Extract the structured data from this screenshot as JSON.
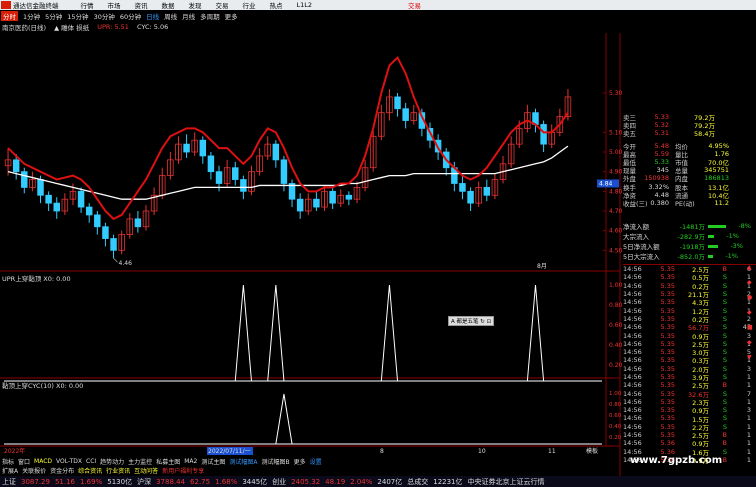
{
  "titlebar": {
    "app": "通达信金融终端",
    "menu": [
      "行情",
      "市场",
      "资讯",
      "数据",
      "发现",
      "交易",
      "行业",
      "热点",
      "L1L2"
    ],
    "trade": "交易"
  },
  "periods": [
    "分时",
    "1分钟",
    "5分钟",
    "15分钟",
    "30分钟",
    "60分钟",
    "日线",
    "周线",
    "月线",
    "多周期",
    "更多"
  ],
  "active_period": "分时",
  "info": {
    "stock": "南京医药(日线)",
    "lock": "▲ 雕体 损纸",
    "upr": "UPR: 5.51",
    "cyc": "CYC: 5.06"
  },
  "price_axis": [
    "5.30",
    "5.10",
    "5.00",
    "4.90",
    "4.80",
    "4.70",
    "4.60",
    "4.50"
  ],
  "low_label": "4.46",
  "price_tag": "4.84",
  "month_marker": "8月",
  "quote_rows": [
    {
      "l": "卖三",
      "p": "5.33",
      "v": "79.2万"
    },
    {
      "l": "卖四",
      "p": "5.32",
      "v": "79.2万"
    },
    {
      "l": "卖五",
      "p": "5.31",
      "v": "58.4万"
    }
  ],
  "stats": [
    {
      "l1": "今开",
      "v1": "5.48",
      "l2": "均价",
      "v2": "4.95%"
    },
    {
      "l1": "最高",
      "v1": "5.59",
      "l2": "量比",
      "v2": "1.76"
    },
    {
      "l1": "最低",
      "v1": "5.33",
      "l2": "市值",
      "v2": "70.0亿"
    },
    {
      "l1": "现量",
      "v1": "345",
      "l2": "总量",
      "v2": "345751"
    },
    {
      "l1": "外盘",
      "v1": "150938",
      "l2": "内盘",
      "v2": "186813"
    },
    {
      "l1": "换手",
      "v1": "3.32%",
      "l2": "股本",
      "v2": "13.1亿"
    },
    {
      "l1": "净资",
      "v1": "4.48",
      "l2": "流通",
      "v2": "10.4亿"
    },
    {
      "l1": "收益(三)",
      "v1": "0.380",
      "l2": "PE(动)",
      "v2": "11.2"
    }
  ],
  "flows": [
    {
      "label": "净流入额",
      "value": "-1481万",
      "pct": "-8%"
    },
    {
      "label": "大宗流入",
      "value": "-282.9万",
      "pct": "-1%"
    },
    {
      "label": "5日净流入额",
      "value": "-1918万",
      "pct": "-3%"
    },
    {
      "label": "5日大宗流入",
      "value": "-852.0万",
      "pct": "-1%"
    }
  ],
  "ticks": [
    {
      "t": "14:56",
      "p": "5.35",
      "v": "2.5万",
      "s": "B",
      "n": "6"
    },
    {
      "t": "14:56",
      "p": "5.35",
      "v": "0.5万",
      "s": "S",
      "n": "1"
    },
    {
      "t": "14:56",
      "p": "5.35",
      "v": "0.2万",
      "s": "S",
      "n": "1"
    },
    {
      "t": "14:56",
      "p": "5.35",
      "v": "21.1万",
      "s": "S",
      "n": "2"
    },
    {
      "t": "14:56",
      "p": "5.35",
      "v": "4.3万",
      "s": "S",
      "n": "1"
    },
    {
      "t": "14:56",
      "p": "5.35",
      "v": "1.2万",
      "s": "S",
      "n": "1"
    },
    {
      "t": "14:56",
      "p": "5.35",
      "v": "0.2万",
      "s": "S",
      "n": "2"
    },
    {
      "t": "14:56",
      "p": "5.35",
      "v": "56.7万",
      "s": "S",
      "n": "45"
    },
    {
      "t": "14:56",
      "p": "5.35",
      "v": "0.9万",
      "s": "S",
      "n": "3"
    },
    {
      "t": "14:56",
      "p": "5.35",
      "v": "2.5万",
      "s": "S",
      "n": "1"
    },
    {
      "t": "14:56",
      "p": "5.35",
      "v": "3.0万",
      "s": "S",
      "n": "5"
    },
    {
      "t": "14:56",
      "p": "5.35",
      "v": "0.3万",
      "s": "S",
      "n": "1"
    },
    {
      "t": "14:56",
      "p": "5.35",
      "v": "2.0万",
      "s": "S",
      "n": "3"
    },
    {
      "t": "14:56",
      "p": "5.35",
      "v": "3.9万",
      "s": "S",
      "n": "1"
    },
    {
      "t": "14:56",
      "p": "5.35",
      "v": "2.5万",
      "s": "B",
      "n": "1"
    },
    {
      "t": "14:56",
      "p": "5.35",
      "v": "32.6万",
      "s": "S",
      "n": "7"
    },
    {
      "t": "14:56",
      "p": "5.35",
      "v": "2.3万",
      "s": "S",
      "n": "1"
    },
    {
      "t": "14:56",
      "p": "5.35",
      "v": "0.9万",
      "s": "S",
      "n": "3"
    },
    {
      "t": "14:56",
      "p": "5.35",
      "v": "1.5万",
      "s": "S",
      "n": "1"
    },
    {
      "t": "14:56",
      "p": "5.35",
      "v": "2.2万",
      "s": "S",
      "n": "1"
    },
    {
      "t": "14:56",
      "p": "5.35",
      "v": "2.5万",
      "s": "B",
      "n": "1"
    },
    {
      "t": "14:56",
      "p": "5.36",
      "v": "0.9万",
      "s": "B",
      "n": "1"
    },
    {
      "t": "14:56",
      "p": "5.36",
      "v": "1.6万",
      "s": "S",
      "n": "1"
    },
    {
      "t": "14:56",
      "p": "5.36",
      "v": "0.9万",
      "s": "B",
      "n": "1"
    }
  ],
  "indicator1": {
    "label": "UPR上穿黏顶  X0: 0.00",
    "axis": [
      "1.00",
      "0.80",
      "0.60",
      "0.40",
      "0.20"
    ]
  },
  "indicator2": {
    "label": "黏顶上穿CYC(10)  X0: 0.00",
    "axis": [
      "1.00",
      "0.80",
      "0.60",
      "0.40",
      "0.20"
    ]
  },
  "tag": "A 都是五笔 ↻ ⊡",
  "date_axis": [
    "2022年",
    "2022/07/11/一",
    "8",
    "10",
    "11"
  ],
  "date_right": "模板",
  "tabs1": [
    "指标",
    "窗口",
    "MACD",
    "VOL-TDX",
    "CCI",
    "趋势动力",
    "主力监控",
    "私募主图",
    "MA2",
    "测试主图",
    "测试幅图A",
    "测试幅图B",
    "更多",
    "设置"
  ],
  "tabs2": [
    "扩展A",
    "关联报价",
    "资金分布",
    "综合资讯",
    "行业资讯",
    "互动问答",
    "新用户福利专享"
  ],
  "status": {
    "sh_label": "上证",
    "sh": "3087.29",
    "sh_chg": "51.16",
    "sh_pct": "1.69%",
    "sh_amt": "5130亿",
    "hs_label": "沪深",
    "hs": "3788.44",
    "hs_chg": "62.75",
    "hs_pct": "1.68%",
    "hs_amt": "3445亿",
    "cy_label": "创业",
    "cy": "2405.32",
    "cy_chg": "48.19",
    "cy_pct": "2.04%",
    "cy_amt": "2407亿",
    "total_label": "总成交",
    "total": "12231亿",
    "note": "中央证券北京上证云行情"
  },
  "watermark": "www.7gpzb.com",
  "colors": {
    "up": "#e33333",
    "down": "#33ccff",
    "ma_white": "#ffffff",
    "upr_red": "#dd1111"
  },
  "chart_data": {
    "type": "candlestick",
    "candles": [
      {
        "o": 4.93,
        "c": 4.96,
        "h": 5.02,
        "l": 4.88
      },
      {
        "o": 4.96,
        "c": 4.9,
        "h": 4.99,
        "l": 4.86
      },
      {
        "o": 4.9,
        "c": 4.82,
        "h": 4.92,
        "l": 4.79
      },
      {
        "o": 4.82,
        "c": 4.86,
        "h": 4.9,
        "l": 4.8
      },
      {
        "o": 4.86,
        "c": 4.78,
        "h": 4.88,
        "l": 4.74
      },
      {
        "o": 4.78,
        "c": 4.74,
        "h": 4.8,
        "l": 4.7
      },
      {
        "o": 4.74,
        "c": 4.7,
        "h": 4.77,
        "l": 4.66
      },
      {
        "o": 4.7,
        "c": 4.76,
        "h": 4.79,
        "l": 4.68
      },
      {
        "o": 4.76,
        "c": 4.8,
        "h": 4.84,
        "l": 4.73
      },
      {
        "o": 4.8,
        "c": 4.72,
        "h": 4.82,
        "l": 4.69
      },
      {
        "o": 4.72,
        "c": 4.68,
        "h": 4.74,
        "l": 4.64
      },
      {
        "o": 4.68,
        "c": 4.62,
        "h": 4.7,
        "l": 4.58
      },
      {
        "o": 4.62,
        "c": 4.56,
        "h": 4.64,
        "l": 4.52
      },
      {
        "o": 4.56,
        "c": 4.5,
        "h": 4.58,
        "l": 4.46
      },
      {
        "o": 4.5,
        "c": 4.58,
        "h": 4.6,
        "l": 4.48
      },
      {
        "o": 4.58,
        "c": 4.66,
        "h": 4.69,
        "l": 4.56
      },
      {
        "o": 4.66,
        "c": 4.62,
        "h": 4.7,
        "l": 4.59
      },
      {
        "o": 4.62,
        "c": 4.7,
        "h": 4.73,
        "l": 4.6
      },
      {
        "o": 4.7,
        "c": 4.78,
        "h": 4.82,
        "l": 4.68
      },
      {
        "o": 4.78,
        "c": 4.88,
        "h": 4.92,
        "l": 4.76
      },
      {
        "o": 4.88,
        "c": 4.96,
        "h": 5.0,
        "l": 4.86
      },
      {
        "o": 4.96,
        "c": 5.04,
        "h": 5.08,
        "l": 4.94
      },
      {
        "o": 5.04,
        "c": 5.0,
        "h": 5.09,
        "l": 4.97
      },
      {
        "o": 5.0,
        "c": 5.06,
        "h": 5.1,
        "l": 4.98
      },
      {
        "o": 5.06,
        "c": 4.98,
        "h": 5.08,
        "l": 4.94
      },
      {
        "o": 4.98,
        "c": 4.9,
        "h": 5.0,
        "l": 4.86
      },
      {
        "o": 4.9,
        "c": 4.84,
        "h": 4.93,
        "l": 4.8
      },
      {
        "o": 4.84,
        "c": 4.92,
        "h": 4.96,
        "l": 4.82
      },
      {
        "o": 4.92,
        "c": 4.86,
        "h": 4.95,
        "l": 4.83
      },
      {
        "o": 4.86,
        "c": 4.8,
        "h": 4.88,
        "l": 4.76
      },
      {
        "o": 4.8,
        "c": 4.9,
        "h": 4.93,
        "l": 4.78
      },
      {
        "o": 4.9,
        "c": 4.98,
        "h": 5.02,
        "l": 4.88
      },
      {
        "o": 4.98,
        "c": 5.04,
        "h": 5.08,
        "l": 4.96
      },
      {
        "o": 5.04,
        "c": 4.96,
        "h": 5.06,
        "l": 4.92
      },
      {
        "o": 4.96,
        "c": 4.84,
        "h": 4.98,
        "l": 4.8
      },
      {
        "o": 4.84,
        "c": 4.76,
        "h": 4.86,
        "l": 4.72
      },
      {
        "o": 4.76,
        "c": 4.7,
        "h": 4.79,
        "l": 4.66
      },
      {
        "o": 4.7,
        "c": 4.76,
        "h": 4.79,
        "l": 4.68
      },
      {
        "o": 4.76,
        "c": 4.72,
        "h": 4.8,
        "l": 4.7
      },
      {
        "o": 4.72,
        "c": 4.8,
        "h": 4.83,
        "l": 4.7
      },
      {
        "o": 4.8,
        "c": 4.74,
        "h": 4.82,
        "l": 4.71
      },
      {
        "o": 4.74,
        "c": 4.78,
        "h": 4.81,
        "l": 4.72
      },
      {
        "o": 4.78,
        "c": 4.76,
        "h": 4.8,
        "l": 4.73
      },
      {
        "o": 4.76,
        "c": 4.82,
        "h": 4.85,
        "l": 4.74
      },
      {
        "o": 4.82,
        "c": 4.92,
        "h": 4.96,
        "l": 4.8
      },
      {
        "o": 4.92,
        "c": 5.08,
        "h": 5.12,
        "l": 4.9
      },
      {
        "o": 5.08,
        "c": 5.2,
        "h": 5.24,
        "l": 5.06
      },
      {
        "o": 5.2,
        "c": 5.28,
        "h": 5.32,
        "l": 5.16
      },
      {
        "o": 5.28,
        "c": 5.22,
        "h": 5.3,
        "l": 5.18
      },
      {
        "o": 5.22,
        "c": 5.16,
        "h": 5.25,
        "l": 5.12
      },
      {
        "o": 5.16,
        "c": 5.2,
        "h": 5.24,
        "l": 5.14
      },
      {
        "o": 5.2,
        "c": 5.12,
        "h": 5.22,
        "l": 5.08
      },
      {
        "o": 5.12,
        "c": 5.06,
        "h": 5.15,
        "l": 5.02
      },
      {
        "o": 5.06,
        "c": 5.0,
        "h": 5.09,
        "l": 4.96
      },
      {
        "o": 5.0,
        "c": 4.92,
        "h": 5.02,
        "l": 4.88
      },
      {
        "o": 4.92,
        "c": 4.84,
        "h": 4.95,
        "l": 4.8
      },
      {
        "o": 4.84,
        "c": 4.8,
        "h": 4.88,
        "l": 4.76
      },
      {
        "o": 4.8,
        "c": 4.74,
        "h": 4.82,
        "l": 4.7
      },
      {
        "o": 4.74,
        "c": 4.82,
        "h": 4.85,
        "l": 4.72
      },
      {
        "o": 4.82,
        "c": 4.78,
        "h": 4.86,
        "l": 4.75
      },
      {
        "o": 4.78,
        "c": 4.86,
        "h": 4.89,
        "l": 4.76
      },
      {
        "o": 4.86,
        "c": 4.94,
        "h": 4.98,
        "l": 4.84
      },
      {
        "o": 4.94,
        "c": 5.04,
        "h": 5.08,
        "l": 4.92
      },
      {
        "o": 5.04,
        "c": 5.12,
        "h": 5.16,
        "l": 5.02
      },
      {
        "o": 5.12,
        "c": 5.2,
        "h": 5.24,
        "l": 5.1
      },
      {
        "o": 5.2,
        "c": 5.14,
        "h": 5.22,
        "l": 5.1
      },
      {
        "o": 5.14,
        "c": 5.04,
        "h": 5.16,
        "l": 5.0
      },
      {
        "o": 5.04,
        "c": 5.1,
        "h": 5.14,
        "l": 5.02
      },
      {
        "o": 5.1,
        "c": 5.18,
        "h": 5.22,
        "l": 5.08
      },
      {
        "o": 5.18,
        "c": 5.28,
        "h": 5.32,
        "l": 5.16
      }
    ],
    "ma": [
      4.9,
      4.89,
      4.88,
      4.87,
      4.86,
      4.85,
      4.84,
      4.83,
      4.82,
      4.81,
      4.8,
      4.79,
      4.78,
      4.77,
      4.76,
      4.76,
      4.76,
      4.76,
      4.77,
      4.78,
      4.79,
      4.8,
      4.81,
      4.82,
      4.82,
      4.82,
      4.82,
      4.82,
      4.82,
      4.82,
      4.82,
      4.83,
      4.83,
      4.83,
      4.83,
      4.83,
      4.83,
      4.83,
      4.83,
      4.83,
      4.83,
      4.83,
      4.84,
      4.84,
      4.85,
      4.86,
      4.87,
      4.88,
      4.88,
      4.88,
      4.89,
      4.89,
      4.89,
      4.89,
      4.89,
      4.89,
      4.89,
      4.89,
      4.89,
      4.89,
      4.89,
      4.9,
      4.91,
      4.92,
      4.93,
      4.94,
      4.95,
      4.97,
      5.0,
      5.03
    ],
    "upr": [
      5.02,
      4.98,
      4.94,
      4.92,
      4.9,
      4.88,
      4.86,
      4.87,
      4.88,
      4.86,
      4.82,
      4.76,
      4.7,
      4.66,
      4.68,
      4.74,
      4.8,
      4.86,
      4.94,
      5.02,
      5.08,
      5.1,
      5.12,
      5.12,
      5.1,
      5.06,
      5.02,
      5.02,
      4.98,
      4.94,
      4.98,
      5.06,
      5.12,
      5.1,
      5.02,
      4.92,
      4.84,
      4.8,
      4.8,
      4.82,
      4.82,
      4.84,
      4.84,
      4.88,
      4.98,
      5.12,
      5.3,
      5.44,
      5.48,
      5.4,
      5.28,
      5.18,
      5.1,
      5.02,
      4.96,
      4.92,
      4.88,
      4.86,
      4.88,
      4.92,
      4.98,
      5.04,
      5.1,
      5.14,
      5.16,
      5.14,
      5.1,
      5.1,
      5.14,
      5.2
    ],
    "signal1": [
      0,
      0,
      0,
      0,
      0,
      0,
      0,
      0,
      0,
      0,
      0,
      0,
      0,
      0,
      0,
      0,
      0,
      0,
      0,
      0,
      0,
      0,
      0,
      0,
      0,
      0,
      0,
      0,
      0,
      1,
      0,
      0,
      0,
      1,
      0,
      0,
      0,
      0,
      0,
      0,
      0,
      0,
      0,
      0,
      0,
      0,
      0,
      1,
      0,
      0,
      0,
      0,
      0,
      0,
      0,
      0,
      0,
      0,
      0,
      0,
      0,
      0,
      0,
      0,
      0,
      1,
      0,
      0,
      0,
      0
    ],
    "signal2": [
      0,
      0,
      0,
      0,
      0,
      0,
      0,
      0,
      0,
      0,
      0,
      0,
      0,
      0,
      0,
      0,
      0,
      0,
      0,
      0,
      0,
      0,
      0,
      0,
      0,
      0,
      0,
      0,
      0,
      0,
      0,
      0,
      0,
      0,
      1,
      0,
      0,
      0,
      0,
      0,
      0,
      0,
      0,
      0,
      0,
      0,
      0,
      0,
      0,
      0,
      0,
      0,
      0,
      0,
      0,
      0,
      0,
      0,
      0,
      0,
      0,
      0,
      0,
      0,
      0,
      0,
      0,
      0,
      0,
      0
    ],
    "ylim": [
      4.4,
      5.6
    ]
  }
}
